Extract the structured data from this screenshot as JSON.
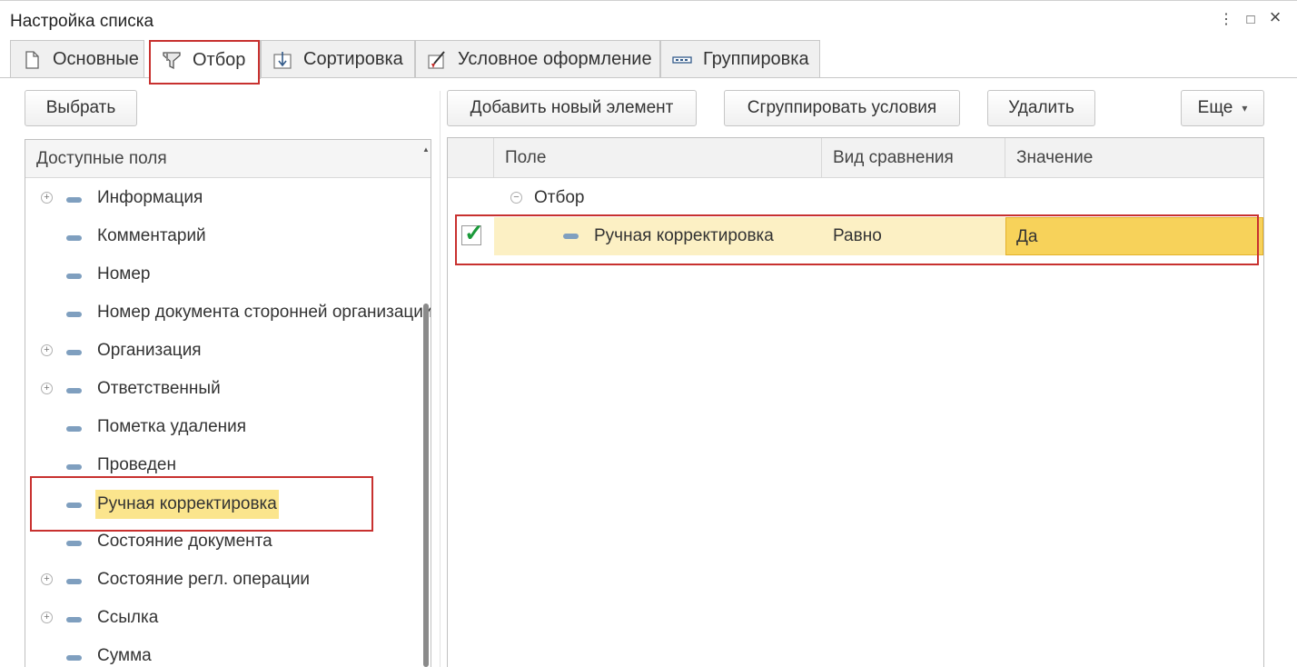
{
  "window": {
    "title": "Настройка списка",
    "menu_icon": "⋮",
    "maximize_icon": "□",
    "close_icon": "×"
  },
  "tabs": [
    {
      "label": "Основные",
      "icon": "document-icon"
    },
    {
      "label": "Отбор",
      "icon": "filter-icon",
      "active": true
    },
    {
      "label": "Сортировка",
      "icon": "sort-icon"
    },
    {
      "label": "Условное оформление",
      "icon": "brush-icon"
    },
    {
      "label": "Группировка",
      "icon": "grouping-icon"
    }
  ],
  "left_toolbar": {
    "select_button": "Выбрать"
  },
  "available_fields": {
    "header": "Доступные поля",
    "items": [
      {
        "label": "Информация",
        "expandable": true
      },
      {
        "label": "Комментарий",
        "expandable": false
      },
      {
        "label": "Номер",
        "expandable": false
      },
      {
        "label": "Номер документа сторонней организации",
        "expandable": false
      },
      {
        "label": "Организация",
        "expandable": true
      },
      {
        "label": "Ответственный",
        "expandable": true
      },
      {
        "label": "Пометка удаления",
        "expandable": false
      },
      {
        "label": "Проведен",
        "expandable": false
      },
      {
        "label": "Ручная корректировка",
        "expandable": false,
        "selected": true
      },
      {
        "label": "Состояние документа",
        "expandable": false
      },
      {
        "label": "Состояние регл. операции",
        "expandable": true
      },
      {
        "label": "Ссылка",
        "expandable": true
      },
      {
        "label": "Сумма",
        "expandable": false
      }
    ]
  },
  "right_toolbar": {
    "add_button": "Добавить новый элемент",
    "group_button": "Сгруппировать условия",
    "delete_button": "Удалить",
    "more_button": "Еще",
    "more_arrow": "▾"
  },
  "filter_table": {
    "columns": [
      "Поле",
      "Вид сравнения",
      "Значение"
    ],
    "group_label": "Отбор",
    "rows": [
      {
        "checked": true,
        "field": "Ручная корректировка",
        "comparison": "Равно",
        "value": "Да"
      }
    ]
  },
  "colors": {
    "highlight": "#fbe58d",
    "value_cell": "#f7d25a",
    "annotation_red": "#c8312f",
    "check_green": "#1b9a3a"
  }
}
